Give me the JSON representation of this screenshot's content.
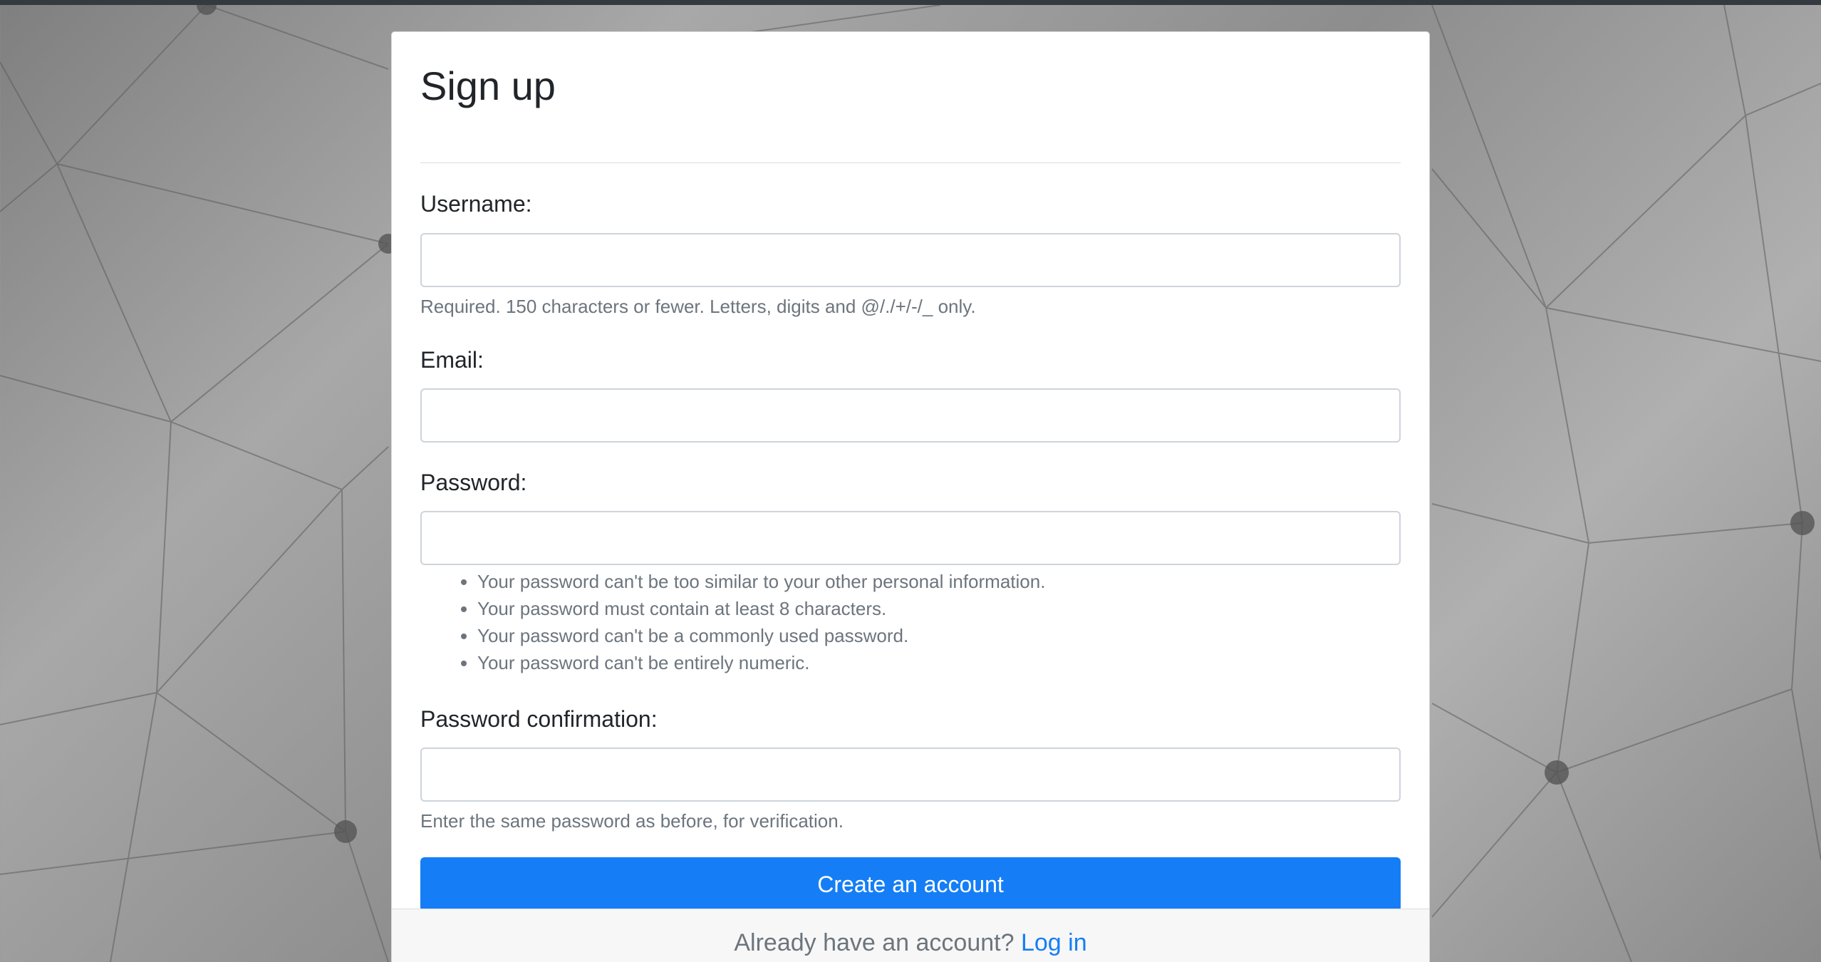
{
  "form": {
    "title": "Sign up",
    "username": {
      "label": "Username:",
      "value": "",
      "help": "Required. 150 characters or fewer. Letters, digits and @/./+/-/_ only."
    },
    "email": {
      "label": "Email:",
      "value": ""
    },
    "password": {
      "label": "Password:",
      "value": "",
      "rules": [
        "Your password can't be too similar to your other personal information.",
        "Your password must contain at least 8 characters.",
        "Your password can't be a commonly used password.",
        "Your password can't be entirely numeric."
      ]
    },
    "password_confirmation": {
      "label": "Password confirmation:",
      "value": "",
      "help": "Enter the same password as before, for verification."
    },
    "submit_label": "Create an account"
  },
  "footer": {
    "prompt": "Already have an account?",
    "login_link": "Log in"
  },
  "colors": {
    "primary": "#157ef6",
    "top_bar": "#343a40"
  }
}
